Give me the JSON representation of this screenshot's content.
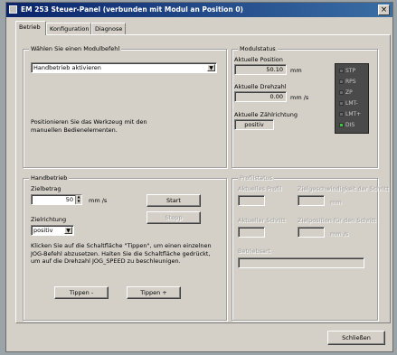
{
  "window": {
    "title": "EM 253 Steuer-Panel (verbunden mit Modul an Position 0)",
    "close_glyph": "×"
  },
  "tabs": [
    {
      "label": "Betrieb",
      "active": true
    },
    {
      "label": "Konfiguration",
      "active": false
    },
    {
      "label": "Diagnose",
      "active": false
    }
  ],
  "command": {
    "label": "Wählen Sie einen Modulbefehl",
    "selected": "Handbetrieb aktivieren",
    "help": "Positionieren Sie das Werkzeug mit den manuellen Bedienelementen."
  },
  "status": {
    "group_label": "Modulstatus",
    "position_label": "Aktuelle Position",
    "position_value": "50.10",
    "position_unit": "mm",
    "speed_label": "Aktuelle Drehzahl",
    "speed_value": "0.00",
    "speed_unit": "mm /s",
    "direction_label": "Aktuelle Zählrichtung",
    "direction_value": "positiv",
    "leds": [
      {
        "label": "STP",
        "on": false
      },
      {
        "label": "RPS",
        "on": false
      },
      {
        "label": "ZP",
        "on": false
      },
      {
        "label": "LMT-",
        "on": false
      },
      {
        "label": "LMT+",
        "on": false
      },
      {
        "label": "DIS",
        "on": true
      }
    ]
  },
  "manual": {
    "group_label": "Handbetrieb",
    "speed_label": "Zielbetrag",
    "speed_value": "50",
    "speed_unit": "mm /s",
    "start_label": "Start",
    "stop_label": "Stopp",
    "direction_label": "Zielrichtung",
    "direction_value": "positiv",
    "help": "Klicken Sie auf die Schaltfläche \"Tippen\", um einen einzelnen JOG-Befehl abzusetzen. Halten Sie die Schaltfläche gedrückt, um auf die Drehzahl JOG_SPEED zu beschleunigen.",
    "jog_minus": "Tippen -",
    "jog_plus": "Tippen +"
  },
  "profile": {
    "group_label": "Profilstatus",
    "profile_label": "Aktuelles Profil",
    "target_speed_label": "Zielgeschwindigkeit der Schritt",
    "target_speed_unit": "mm",
    "step_label": "Aktueller Schritt",
    "step_target_label": "Zielposition für den Schritt",
    "step_target_unit": "mm /s",
    "mode_label": "Betriebsart"
  },
  "footer": {
    "close_label": "Schließen"
  }
}
